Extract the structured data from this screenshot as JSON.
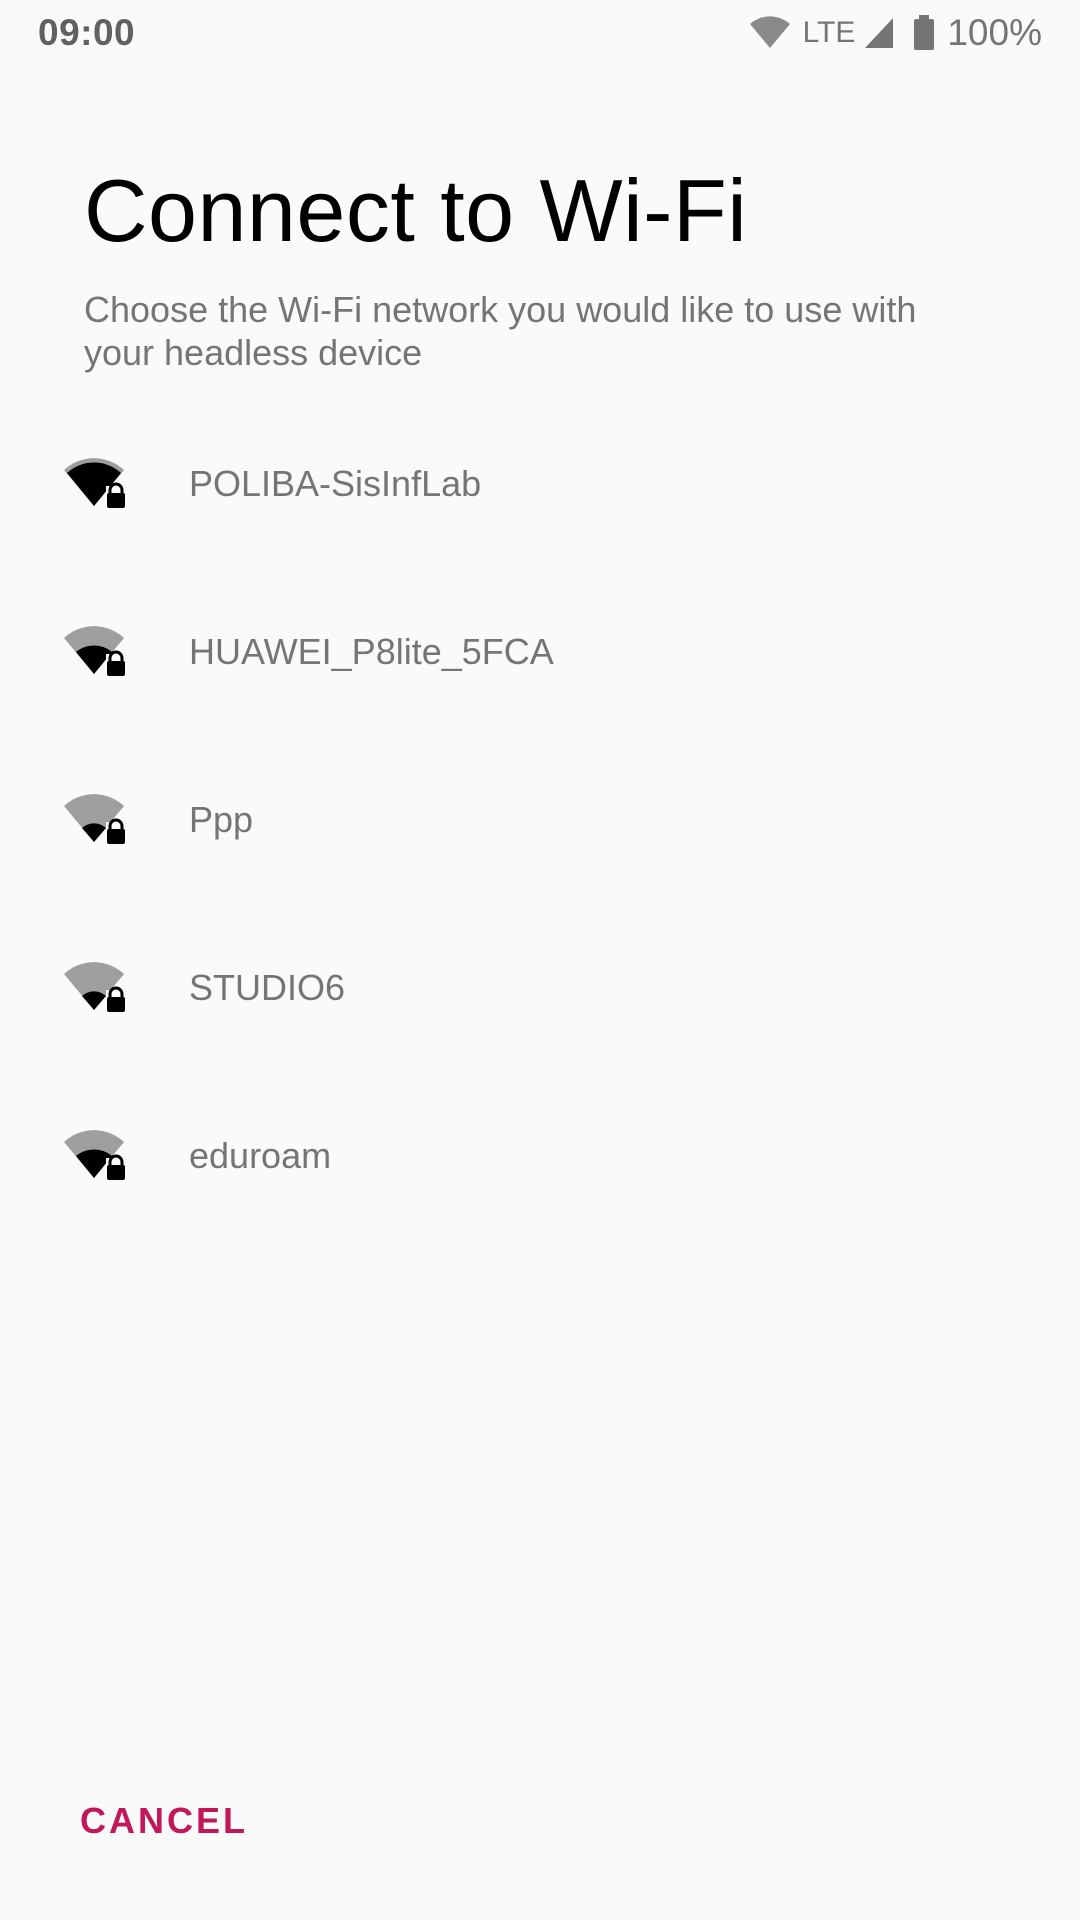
{
  "status_bar": {
    "time": "09:00",
    "network_type": "LTE",
    "battery": "100%"
  },
  "title": "Connect to Wi-Fi",
  "subtitle": "Choose the Wi-Fi network you would like to use with your headless device",
  "networks": [
    {
      "ssid": "POLIBA-SisInfLab",
      "signal_bars": 4,
      "secured": true,
      "icon": "wifi-lock-icon"
    },
    {
      "ssid": "HUAWEI_P8lite_5FCA",
      "signal_bars": 2,
      "secured": true,
      "icon": "wifi-lock-icon"
    },
    {
      "ssid": "Ppp",
      "signal_bars": 1,
      "secured": true,
      "icon": "wifi-lock-icon"
    },
    {
      "ssid": "STUDIO6",
      "signal_bars": 1,
      "secured": true,
      "icon": "wifi-lock-icon"
    },
    {
      "ssid": "eduroam",
      "signal_bars": 2,
      "secured": true,
      "icon": "wifi-lock-icon"
    }
  ],
  "cancel_label": "CANCEL",
  "colors": {
    "background": "#fafafa",
    "title": "#000000",
    "secondary_text": "#757575",
    "accent": "#c2185b",
    "wifi_active": "#000000",
    "wifi_inactive": "#9e9e9e"
  }
}
